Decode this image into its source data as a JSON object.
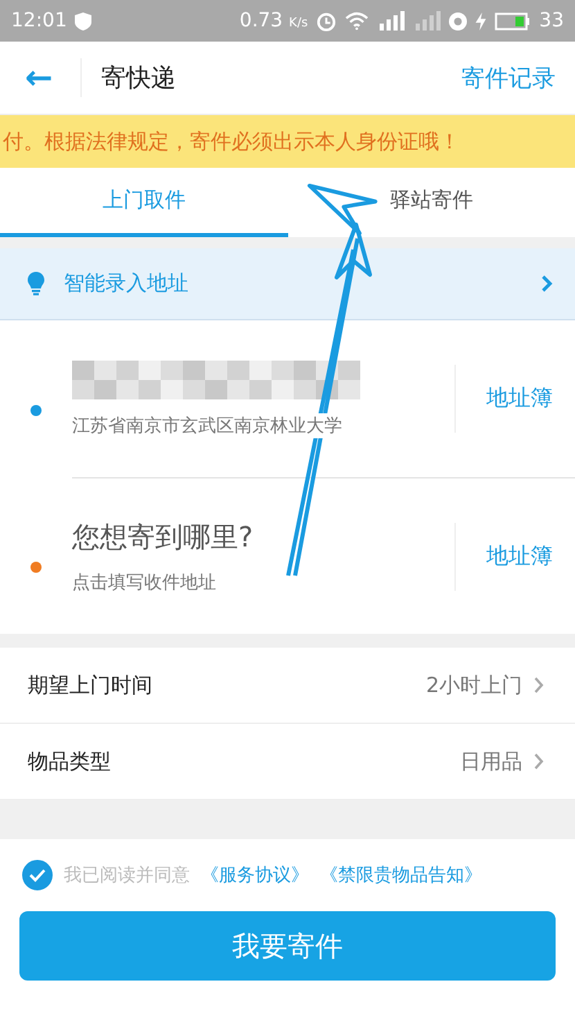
{
  "status_bar": {
    "time": "12:01",
    "speed": "0.73",
    "speed_unit": "K/s",
    "battery": "33"
  },
  "header": {
    "back": "←",
    "title": "寄快递",
    "action": "寄件记录"
  },
  "notice": {
    "text": "付。根据法律规定，寄件必须出示本人身份证哦！"
  },
  "tabs": [
    {
      "label": "上门取件",
      "selected": true
    },
    {
      "label": "驿站寄件",
      "selected": false
    }
  ],
  "smart_entry": {
    "label": "智能录入地址"
  },
  "addresses": [
    {
      "kind": "sender",
      "color": "#1a9be0",
      "title_blurred": true,
      "detail": "江苏省南京市玄武区南京林业大学",
      "book": "地址簿"
    },
    {
      "kind": "receiver",
      "color": "#f07c22",
      "title": "您想寄到哪里?",
      "detail": "点击填写收件地址",
      "book": "地址簿"
    }
  ],
  "options": [
    {
      "label": "期望上门时间",
      "value": "2小时上门"
    },
    {
      "label": "物品类型",
      "value": "日用品"
    }
  ],
  "agreement": {
    "checked": true,
    "text": "我已阅读并同意",
    "links": [
      "《服务协议》",
      "《禁限贵物品告知》"
    ]
  },
  "submit": {
    "label": "我要寄件"
  }
}
